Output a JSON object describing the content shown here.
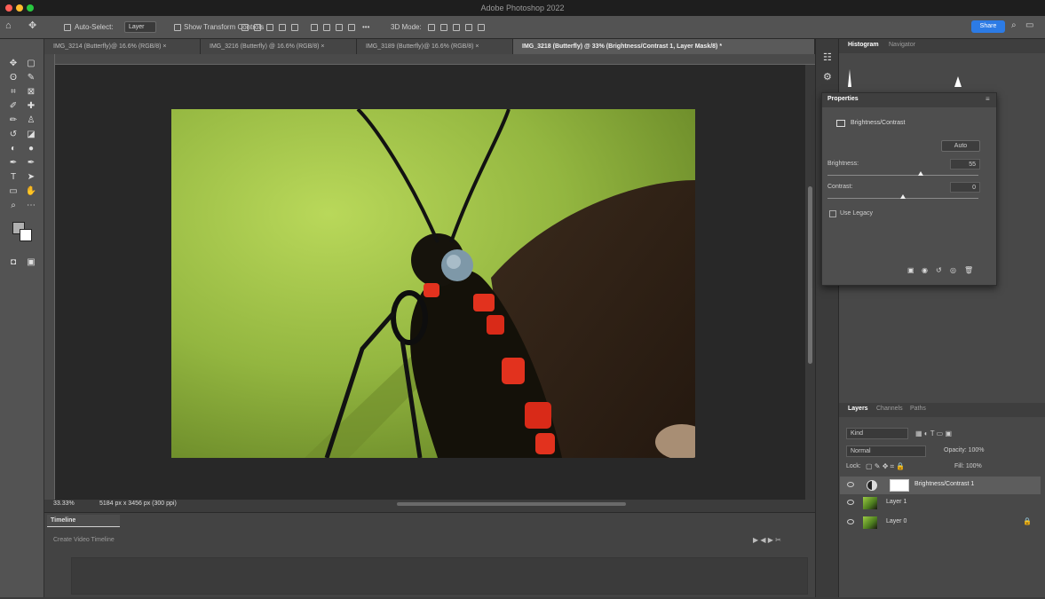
{
  "window": {
    "title": "Adobe Photoshop 2022"
  },
  "options_bar": {
    "auto_select_label": "Auto-Select:",
    "auto_select_value": "Layer",
    "transform_controls_label": "Show Transform Controls",
    "mode_3d_label": "3D Mode:",
    "share_label": "Share"
  },
  "document_tabs": [
    {
      "label": "IMG_3214 (Butterfly)@ 16.6% (RGB/8) ×",
      "active": false
    },
    {
      "label": "IMG_3216 (Butterfly) @ 16.6% (RGB/8) ×",
      "active": false
    },
    {
      "label": "IMG_3189 (Butterfly)@ 16.6% (RGB/8) ×",
      "active": false
    },
    {
      "label": "IMG_3218 (Butterfly) @ 33% (Brightness/Contrast 1, Layer Mask/8) *",
      "active": true
    }
  ],
  "histogram_panel": {
    "tabs": [
      "Histogram",
      "Navigator"
    ]
  },
  "properties_panel": {
    "title": "Properties",
    "adjustment_label": "Brightness/Contrast",
    "auto_button": "Auto",
    "brightness_label": "Brightness:",
    "brightness_value": "55",
    "contrast_label": "Contrast:",
    "contrast_value": "0",
    "brightness_fraction": 0.62,
    "contrast_fraction": 0.5,
    "use_legacy_label": "Use Legacy"
  },
  "layers_panel": {
    "tabs": [
      "Layers",
      "Channels",
      "Paths"
    ],
    "kind_label": "Kind",
    "blend_mode": "Normal",
    "opacity_label": "Opacity: 100%",
    "lock_label": "Lock:",
    "fill_label": "Fill: 100%",
    "layers": [
      {
        "name": "Brightness/Contrast 1",
        "type": "adjustment",
        "selected": true
      },
      {
        "name": "Layer 1",
        "type": "image",
        "selected": false
      },
      {
        "name": "Layer 0",
        "type": "image",
        "selected": false
      }
    ]
  },
  "status_bar": {
    "zoom": "33.33%",
    "doc_info": "5184 px x 3456 px (300 ppi)"
  },
  "timeline_panel": {
    "title": "Timeline",
    "create_button": "Create Video Timeline"
  },
  "tools": [
    "move-tool",
    "artboard-tool",
    "lasso-tool",
    "quick-select-tool",
    "crop-tool",
    "frame-tool",
    "eyedropper-tool",
    "healing-brush-tool",
    "brush-tool",
    "clone-stamp-tool",
    "history-brush-tool",
    "eraser-tool",
    "gradient-tool",
    "blur-tool",
    "dodge-tool",
    "pen-tool",
    "type-tool",
    "path-selection-tool",
    "rectangle-tool",
    "hand-tool",
    "zoom-tool",
    "more-tools"
  ],
  "colors": {
    "share_button": "#2c7be5",
    "foreground": "#b0b0b0",
    "background": "#ffffff"
  }
}
